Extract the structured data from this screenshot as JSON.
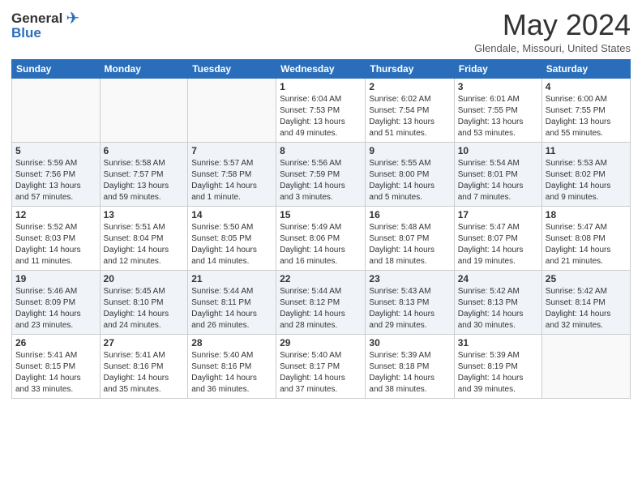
{
  "header": {
    "logo_general": "General",
    "logo_blue": "Blue",
    "month_title": "May 2024",
    "location": "Glendale, Missouri, United States"
  },
  "weekdays": [
    "Sunday",
    "Monday",
    "Tuesday",
    "Wednesday",
    "Thursday",
    "Friday",
    "Saturday"
  ],
  "weeks": [
    [
      {
        "day": "",
        "info": ""
      },
      {
        "day": "",
        "info": ""
      },
      {
        "day": "",
        "info": ""
      },
      {
        "day": "1",
        "info": "Sunrise: 6:04 AM\nSunset: 7:53 PM\nDaylight: 13 hours\nand 49 minutes."
      },
      {
        "day": "2",
        "info": "Sunrise: 6:02 AM\nSunset: 7:54 PM\nDaylight: 13 hours\nand 51 minutes."
      },
      {
        "day": "3",
        "info": "Sunrise: 6:01 AM\nSunset: 7:55 PM\nDaylight: 13 hours\nand 53 minutes."
      },
      {
        "day": "4",
        "info": "Sunrise: 6:00 AM\nSunset: 7:55 PM\nDaylight: 13 hours\nand 55 minutes."
      }
    ],
    [
      {
        "day": "5",
        "info": "Sunrise: 5:59 AM\nSunset: 7:56 PM\nDaylight: 13 hours\nand 57 minutes."
      },
      {
        "day": "6",
        "info": "Sunrise: 5:58 AM\nSunset: 7:57 PM\nDaylight: 13 hours\nand 59 minutes."
      },
      {
        "day": "7",
        "info": "Sunrise: 5:57 AM\nSunset: 7:58 PM\nDaylight: 14 hours\nand 1 minute."
      },
      {
        "day": "8",
        "info": "Sunrise: 5:56 AM\nSunset: 7:59 PM\nDaylight: 14 hours\nand 3 minutes."
      },
      {
        "day": "9",
        "info": "Sunrise: 5:55 AM\nSunset: 8:00 PM\nDaylight: 14 hours\nand 5 minutes."
      },
      {
        "day": "10",
        "info": "Sunrise: 5:54 AM\nSunset: 8:01 PM\nDaylight: 14 hours\nand 7 minutes."
      },
      {
        "day": "11",
        "info": "Sunrise: 5:53 AM\nSunset: 8:02 PM\nDaylight: 14 hours\nand 9 minutes."
      }
    ],
    [
      {
        "day": "12",
        "info": "Sunrise: 5:52 AM\nSunset: 8:03 PM\nDaylight: 14 hours\nand 11 minutes."
      },
      {
        "day": "13",
        "info": "Sunrise: 5:51 AM\nSunset: 8:04 PM\nDaylight: 14 hours\nand 12 minutes."
      },
      {
        "day": "14",
        "info": "Sunrise: 5:50 AM\nSunset: 8:05 PM\nDaylight: 14 hours\nand 14 minutes."
      },
      {
        "day": "15",
        "info": "Sunrise: 5:49 AM\nSunset: 8:06 PM\nDaylight: 14 hours\nand 16 minutes."
      },
      {
        "day": "16",
        "info": "Sunrise: 5:48 AM\nSunset: 8:07 PM\nDaylight: 14 hours\nand 18 minutes."
      },
      {
        "day": "17",
        "info": "Sunrise: 5:47 AM\nSunset: 8:07 PM\nDaylight: 14 hours\nand 19 minutes."
      },
      {
        "day": "18",
        "info": "Sunrise: 5:47 AM\nSunset: 8:08 PM\nDaylight: 14 hours\nand 21 minutes."
      }
    ],
    [
      {
        "day": "19",
        "info": "Sunrise: 5:46 AM\nSunset: 8:09 PM\nDaylight: 14 hours\nand 23 minutes."
      },
      {
        "day": "20",
        "info": "Sunrise: 5:45 AM\nSunset: 8:10 PM\nDaylight: 14 hours\nand 24 minutes."
      },
      {
        "day": "21",
        "info": "Sunrise: 5:44 AM\nSunset: 8:11 PM\nDaylight: 14 hours\nand 26 minutes."
      },
      {
        "day": "22",
        "info": "Sunrise: 5:44 AM\nSunset: 8:12 PM\nDaylight: 14 hours\nand 28 minutes."
      },
      {
        "day": "23",
        "info": "Sunrise: 5:43 AM\nSunset: 8:13 PM\nDaylight: 14 hours\nand 29 minutes."
      },
      {
        "day": "24",
        "info": "Sunrise: 5:42 AM\nSunset: 8:13 PM\nDaylight: 14 hours\nand 30 minutes."
      },
      {
        "day": "25",
        "info": "Sunrise: 5:42 AM\nSunset: 8:14 PM\nDaylight: 14 hours\nand 32 minutes."
      }
    ],
    [
      {
        "day": "26",
        "info": "Sunrise: 5:41 AM\nSunset: 8:15 PM\nDaylight: 14 hours\nand 33 minutes."
      },
      {
        "day": "27",
        "info": "Sunrise: 5:41 AM\nSunset: 8:16 PM\nDaylight: 14 hours\nand 35 minutes."
      },
      {
        "day": "28",
        "info": "Sunrise: 5:40 AM\nSunset: 8:16 PM\nDaylight: 14 hours\nand 36 minutes."
      },
      {
        "day": "29",
        "info": "Sunrise: 5:40 AM\nSunset: 8:17 PM\nDaylight: 14 hours\nand 37 minutes."
      },
      {
        "day": "30",
        "info": "Sunrise: 5:39 AM\nSunset: 8:18 PM\nDaylight: 14 hours\nand 38 minutes."
      },
      {
        "day": "31",
        "info": "Sunrise: 5:39 AM\nSunset: 8:19 PM\nDaylight: 14 hours\nand 39 minutes."
      },
      {
        "day": "",
        "info": ""
      }
    ]
  ]
}
